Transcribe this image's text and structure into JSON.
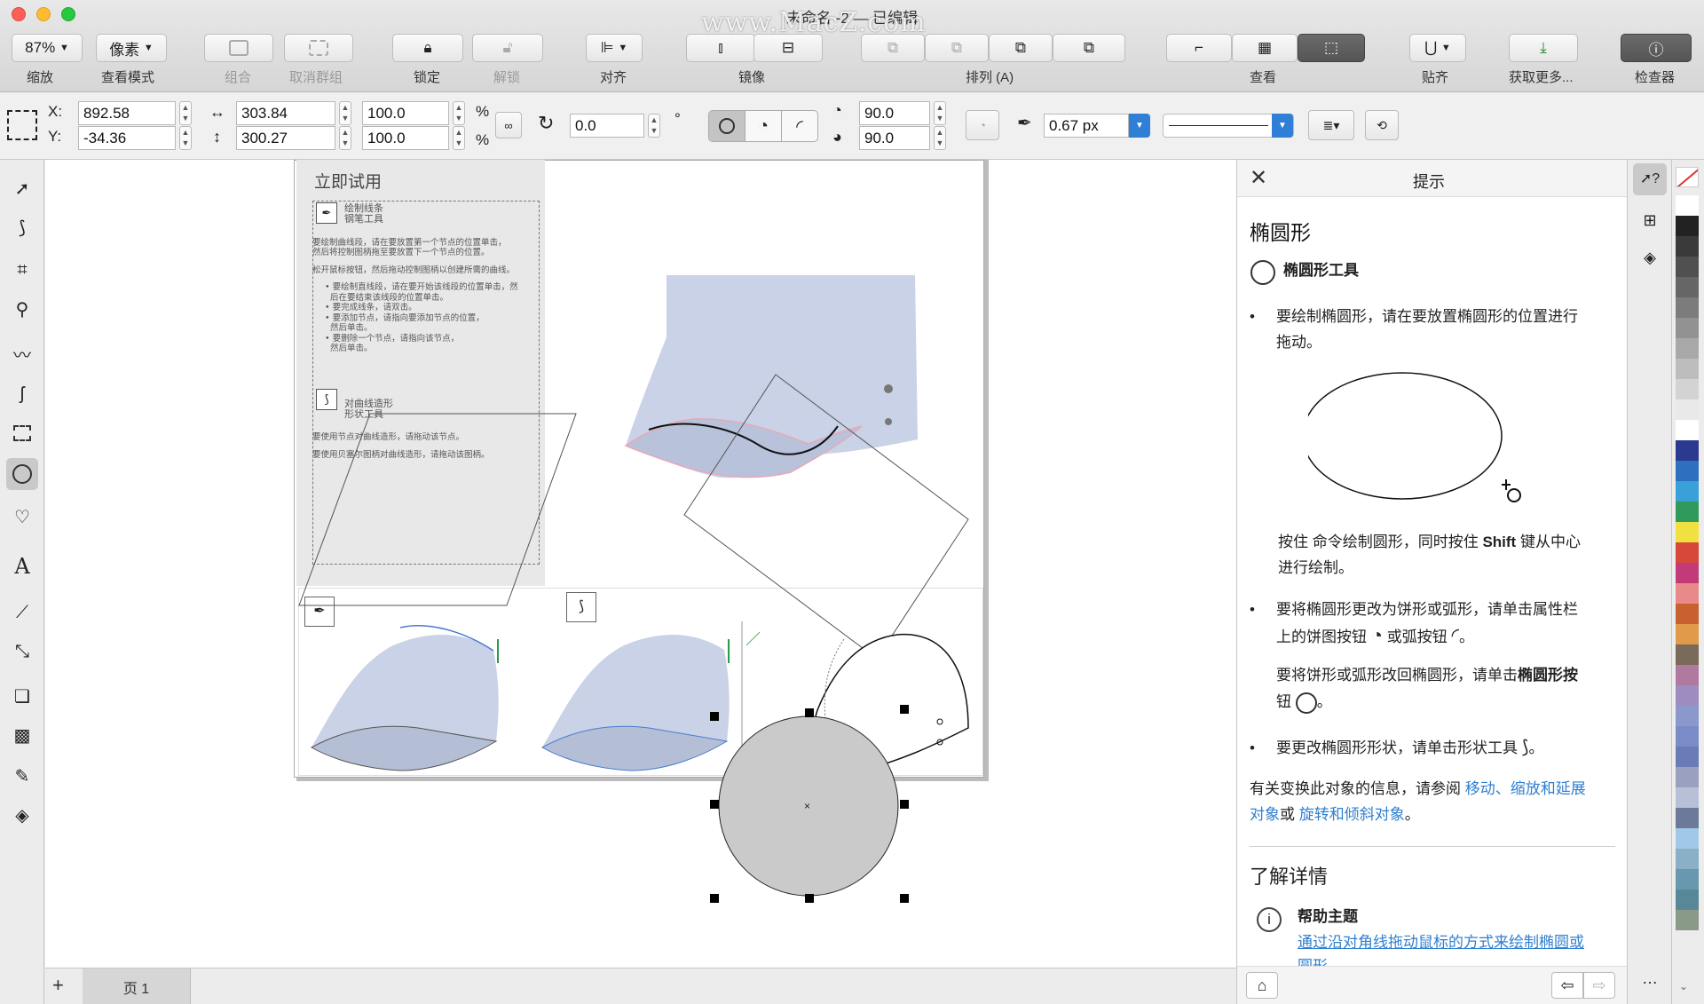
{
  "window": {
    "title": "未命名 -2 — 已编辑",
    "watermark": "www.MacZ.com"
  },
  "toolbar": {
    "zoom_value": "87%",
    "view_mode_value": "像素",
    "labels": {
      "zoom": "缩放",
      "view_mode": "查看模式",
      "group": "组合",
      "ungroup": "取消群组",
      "lock": "锁定",
      "unlock": "解锁",
      "align": "对齐",
      "mirror": "镜像",
      "arrange": "排列 (A)",
      "view": "查看",
      "snap": "贴齐",
      "get_more": "获取更多...",
      "inspector": "检查器"
    }
  },
  "properties": {
    "x_label": "X:",
    "y_label": "Y:",
    "x_value": "892.58",
    "y_value": "-34.36",
    "width_value": "303.84",
    "height_value": "300.27",
    "scale_w": "100.0",
    "scale_h": "100.0",
    "percent": "%",
    "rotation": "0.0",
    "degree": "°",
    "start_angle": "90.0",
    "end_angle": "90.0",
    "outline_width": "0.67 px"
  },
  "document": {
    "panel_title": "立即试用",
    "pen_tool_title1": "绘制线条",
    "pen_tool_title2": "钢笔工具",
    "pen_text1": "要绘制曲线段，请在要放置第一个节点的位置单击，",
    "pen_text2": "然后将控制图柄拖至要放置下一个节点的位置。",
    "pen_text3": "松开鼠标按钮，然后拖动控制图柄以创建所需的曲线。",
    "pen_bullets": [
      "要绘制直线段，请在要开始该线段的位置单击，然",
      "后在要结束该线段的位置单击。",
      "要完成线条，请双击。",
      "要添加节点，请指向要添加节点的位置，",
      "然后单击。",
      "要删除一个节点，请指向该节点，",
      "然后单击。"
    ],
    "shape_tool_title1": "对曲线造形",
    "shape_tool_title2": "形状工具",
    "shape_text1": "要使用节点对曲线造形，请拖动该节点。",
    "shape_text2": "要使用贝塞尔图柄对曲线造形，请拖动该图柄。"
  },
  "pages": {
    "add": "+",
    "page1": "页 1"
  },
  "hints": {
    "panel_title": "提示",
    "heading": "椭圆形",
    "tool_name": "椭圆形工具",
    "bullet1_line1": "要绘制椭圆形，请在要放置椭圆形的位置进行",
    "bullet1_line2": "拖动。",
    "shift_line1_a": "按住 命令绘制圆形，同时按住 ",
    "shift_line1_b": "Shift",
    "shift_line1_c": " 键从中心",
    "shift_line2": "进行绘制。",
    "bullet2_line1": "要将椭圆形更改为饼形或弧形，请单击属性栏",
    "bullet2_line2_a": "上的饼图按钮",
    "bullet2_line2_b": "或弧按钮",
    "bullet2_line2_c": "。",
    "revert_line1_a": "要将饼形或弧形改回椭圆形，请单击",
    "revert_line1_b": "椭圆形按",
    "revert_line2_a": "钮",
    "revert_line2_b": "。",
    "bullet3_a": "要更改椭圆形形状，请单击形状工具",
    "bullet3_b": "。",
    "info_line1_a": "有关变换此对象的信息，请参阅 ",
    "info_link1": "移动、缩放和延展",
    "info_line2_link": "对象",
    "info_line2_or": "或 ",
    "info_link2": "旋转和倾斜对象",
    "info_line2_end": "。",
    "learn_more": "了解详情",
    "help_topic": "帮助主题",
    "help_link_line1": "通过沿对角线拖动鼠标的方式来绘制椭圆或",
    "help_link_line2": "圆形"
  },
  "palette_colors": [
    "#ffffff",
    "#222222",
    "#3a3a3a",
    "#505050",
    "#666666",
    "#7c7c7c",
    "#929292",
    "#a8a8a8",
    "#bdbdbd",
    "#d3d3d3",
    "#e9e9e9",
    "#ffffff",
    "#2b3a8f",
    "#2f6fc0",
    "#3aa0d8",
    "#2f9a5b",
    "#f0e040",
    "#d84838",
    "#c23b78",
    "#e98a8a",
    "#c9602f",
    "#e09a4a",
    "#7a6a5a",
    "#b07aa0",
    "#9d8cc0",
    "#8a98cc",
    "#7a8cc8",
    "#6a7cb8",
    "#9aa0c0",
    "#b8c0d8",
    "#6a7a98",
    "#a0c8e8",
    "#8ab0c8",
    "#6898b0",
    "#588898",
    "#8a9a88"
  ]
}
